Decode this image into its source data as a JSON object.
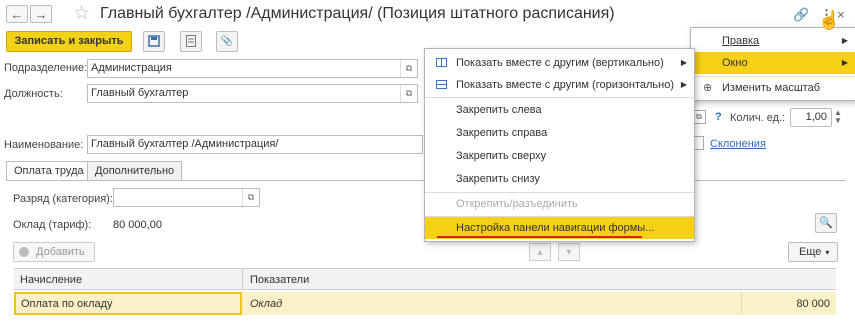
{
  "header": {
    "title": "Главный бухгалтер /Администрация/ (Позиция штатного расписания)",
    "back_icon": "arrow-left-icon",
    "forward_icon": "arrow-right-icon",
    "favorite_icon": "star-icon"
  },
  "toolbar": {
    "save_close_label": "Записать и закрыть"
  },
  "form": {
    "department_label": "Подразделение:",
    "department_value": "Администрация",
    "position_label": "Должность:",
    "position_value": "Главный бухгалтер",
    "name_label": "Наименование:",
    "name_value": "Главный бухгалтер /Администрация/",
    "qty_label": "Колич. ед.:",
    "qty_value": "1,00",
    "help_mark": "?",
    "declension_link": "Склонения"
  },
  "tabs": [
    {
      "label": "Оплата труда",
      "active": true
    },
    {
      "label": "Дополнительно",
      "active": false
    }
  ],
  "pay": {
    "grade_label": "Разряд (категория):",
    "grade_value": "",
    "salary_label": "Оклад (тариф):",
    "salary_value": "80 000,00",
    "add_label": "Добавить",
    "more_label": "Еще",
    "columns": [
      "Начисление",
      "Показатели"
    ],
    "rows": [
      {
        "accrual": "Оплата по окладу",
        "indicator": "Оклад",
        "amount": "80 000"
      }
    ]
  },
  "main_menu": {
    "items": [
      {
        "label": "Правка",
        "highlight": false,
        "submenu": true
      },
      {
        "label": "Окно",
        "highlight": true,
        "submenu": true
      },
      {
        "label": "Изменить масштаб",
        "highlight": false,
        "submenu": false
      }
    ]
  },
  "window_menu": {
    "items": [
      {
        "label": "Показать вместе с другим (вертикально)",
        "submenu": true
      },
      {
        "label": "Показать вместе с другим (горизонтально)",
        "submenu": true
      },
      {
        "label": "Закрепить слева"
      },
      {
        "label": "Закрепить справа"
      },
      {
        "label": "Закрепить сверху"
      },
      {
        "label": "Закрепить снизу"
      },
      {
        "label": "Открепить/разъединить",
        "disabled": true
      },
      {
        "label": "Настройка панели навигации формы...",
        "highlight": true
      }
    ]
  },
  "colors": {
    "accent": "#f5d015",
    "link": "#2c6bb5",
    "underline": "#e02020"
  }
}
